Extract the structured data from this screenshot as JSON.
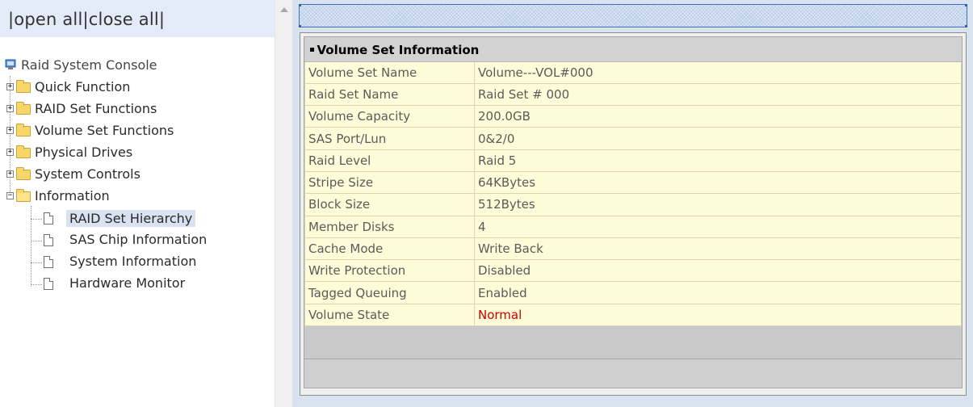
{
  "left": {
    "open_all": "open all",
    "close_all": "close all",
    "sep": "|",
    "tree": {
      "root": "Raid System Console",
      "folders": [
        "Quick Function",
        "RAID Set Functions",
        "Volume Set Functions",
        "Physical Drives",
        "System Controls",
        "Information"
      ],
      "info_children": [
        "RAID Set Hierarchy",
        "SAS Chip Information",
        "System Information",
        "Hardware Monitor"
      ],
      "selected": "RAID Set Hierarchy"
    }
  },
  "main": {
    "section_title": "Volume Set Information",
    "rows": [
      {
        "label": "Volume Set Name",
        "value": "Volume---VOL#000"
      },
      {
        "label": "Raid Set Name",
        "value": "Raid Set # 000"
      },
      {
        "label": "Volume Capacity",
        "value": "200.0GB"
      },
      {
        "label": "SAS Port/Lun",
        "value": "0&2/0"
      },
      {
        "label": "Raid Level",
        "value": "Raid 5"
      },
      {
        "label": "Stripe Size",
        "value": "64KBytes"
      },
      {
        "label": "Block Size",
        "value": "512Bytes"
      },
      {
        "label": "Member Disks",
        "value": "4"
      },
      {
        "label": "Cache Mode",
        "value": "Write Back"
      },
      {
        "label": "Write Protection",
        "value": "Disabled"
      },
      {
        "label": "Tagged Queuing",
        "value": "Enabled"
      },
      {
        "label": "Volume State",
        "value": "Normal",
        "status_color": "#cc0000"
      }
    ]
  },
  "colors": {
    "row_bg": "#fefbd8",
    "header_bg": "#d2d2d2",
    "frame_bg": "#d9e3ef",
    "status_normal": "#cc0000"
  }
}
